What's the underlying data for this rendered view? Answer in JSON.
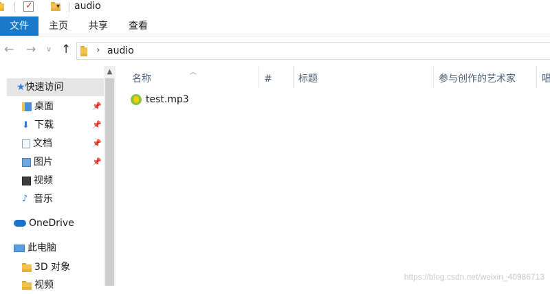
{
  "window": {
    "title": "audio"
  },
  "ribbon": {
    "tabs": [
      {
        "label": "文件",
        "active": true
      },
      {
        "label": "主页"
      },
      {
        "label": "共享"
      },
      {
        "label": "查看"
      }
    ]
  },
  "address": {
    "current_folder": "audio"
  },
  "nav_pane": {
    "quick_access": "快速访问",
    "items": [
      {
        "label": "桌面",
        "pinned": true,
        "icon": "desktop-folder-icon"
      },
      {
        "label": "下载",
        "pinned": true,
        "icon": "downloads-folder-icon"
      },
      {
        "label": "文档",
        "pinned": true,
        "icon": "documents-folder-icon"
      },
      {
        "label": "图片",
        "pinned": true,
        "icon": "pictures-folder-icon"
      },
      {
        "label": "视频",
        "pinned": false,
        "icon": "videos-folder-icon"
      },
      {
        "label": "音乐",
        "pinned": false,
        "icon": "music-folder-icon"
      }
    ],
    "onedrive": "OneDrive",
    "this_pc": "此电脑",
    "pc_items": [
      {
        "label": "3D 对象"
      },
      {
        "label": "视频"
      }
    ]
  },
  "columns": [
    {
      "label": "名称"
    },
    {
      "label": "#"
    },
    {
      "label": "标题"
    },
    {
      "label": "参与创作的艺术家"
    },
    {
      "label": "唱"
    }
  ],
  "files": [
    {
      "name": "test.mp3",
      "icon": "mp3-file-icon"
    }
  ],
  "watermark": "https://blog.csdn.net/weixin_40986713",
  "colors": {
    "accent": "#1979ca",
    "folder": "#f2c14e",
    "selection": "#e5e5e5"
  }
}
